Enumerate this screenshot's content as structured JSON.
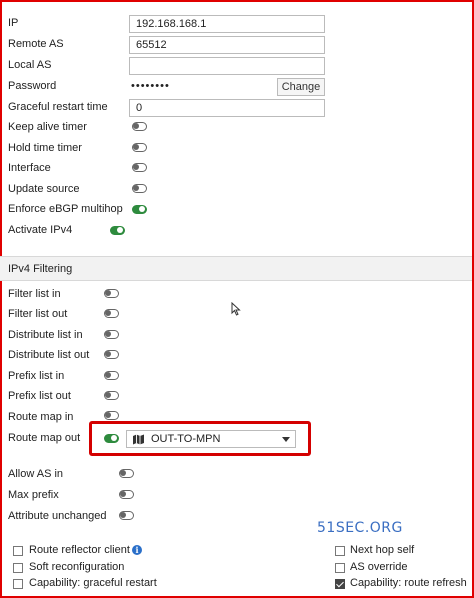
{
  "fields": {
    "ip": {
      "label": "IP",
      "value": "192.168.168.1"
    },
    "remote_as": {
      "label": "Remote AS",
      "value": "65512"
    },
    "local_as": {
      "label": "Local AS",
      "value": ""
    },
    "password": {
      "label": "Password",
      "value": "••••••••",
      "change_label": "Change"
    },
    "graceful_restart_time": {
      "label": "Graceful restart time",
      "value": "0"
    }
  },
  "toggles_top": [
    {
      "label": "Keep alive timer",
      "on": false
    },
    {
      "label": "Hold time timer",
      "on": false
    },
    {
      "label": "Interface",
      "on": false
    },
    {
      "label": "Update source",
      "on": false
    },
    {
      "label": "Enforce eBGP multihop",
      "on": true
    },
    {
      "label": "Activate IPv4",
      "on": true
    }
  ],
  "section": {
    "title": "IPv4 Filtering"
  },
  "filter_toggles": [
    {
      "label": "Filter list in",
      "on": false
    },
    {
      "label": "Filter list out",
      "on": false
    },
    {
      "label": "Distribute list in",
      "on": false
    },
    {
      "label": "Distribute list out",
      "on": false
    },
    {
      "label": "Prefix list in",
      "on": false
    },
    {
      "label": "Prefix list out",
      "on": false
    },
    {
      "label": "Route map in",
      "on": false
    },
    {
      "label": "Route map out",
      "on": true,
      "selected": "OUT-TO-MPN"
    },
    {
      "label": "Allow AS in",
      "on": false
    },
    {
      "label": "Max prefix",
      "on": false
    },
    {
      "label": "Attribute unchanged",
      "on": false
    }
  ],
  "watermark": "51SEC.ORG",
  "checkboxes_left": [
    {
      "label": "Route reflector client",
      "checked": false
    },
    {
      "label": "Soft reconfiguration",
      "checked": false
    },
    {
      "label": "Capability: graceful restart",
      "checked": false
    }
  ],
  "checkboxes_right": [
    {
      "label": "Next hop self",
      "checked": false
    },
    {
      "label": "AS override",
      "checked": false
    },
    {
      "label": "Capability: route refresh",
      "checked": true
    }
  ],
  "colors": {
    "toggle_on": "#2e8b3e",
    "highlight": "#d40000",
    "watermark": "#3a6ec2"
  }
}
